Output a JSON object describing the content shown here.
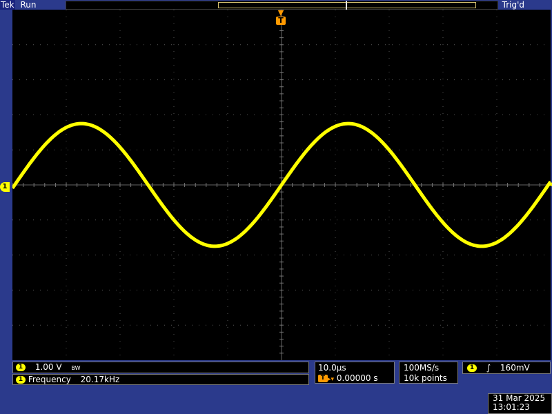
{
  "status": {
    "brand": "Tek",
    "run_state": "Run",
    "trigger_status": "Trig'd"
  },
  "channel": {
    "id": "1",
    "color": "#ffff00",
    "scale": "1.00 V",
    "bw_icon": "BW"
  },
  "measurement": {
    "label": "Frequency",
    "value": "20.17kHz"
  },
  "timebase": {
    "per_div": "10.0µs",
    "trigger_icon": "T",
    "position": "0.00000 s"
  },
  "acquisition": {
    "sample_rate": "100MS/s",
    "record_length": "10k points"
  },
  "trigger": {
    "source": "1",
    "slope_icon": "rising-edge-icon",
    "slope": "∫",
    "level": "160mV"
  },
  "datetime": {
    "date": "31 Mar 2025",
    "time": "13:01:23"
  },
  "colors": {
    "trace": "#ffff00",
    "trigger_marker": "#ff9a00",
    "bezel": "#2b3a8c",
    "screen": "#000000"
  },
  "waveform": {
    "type": "sine",
    "frequency_hz": 20170,
    "timebase_s_per_div": 1e-05,
    "peak_to_peak_divisions": 3.5,
    "phase_at_center": "rising zero crossing"
  }
}
